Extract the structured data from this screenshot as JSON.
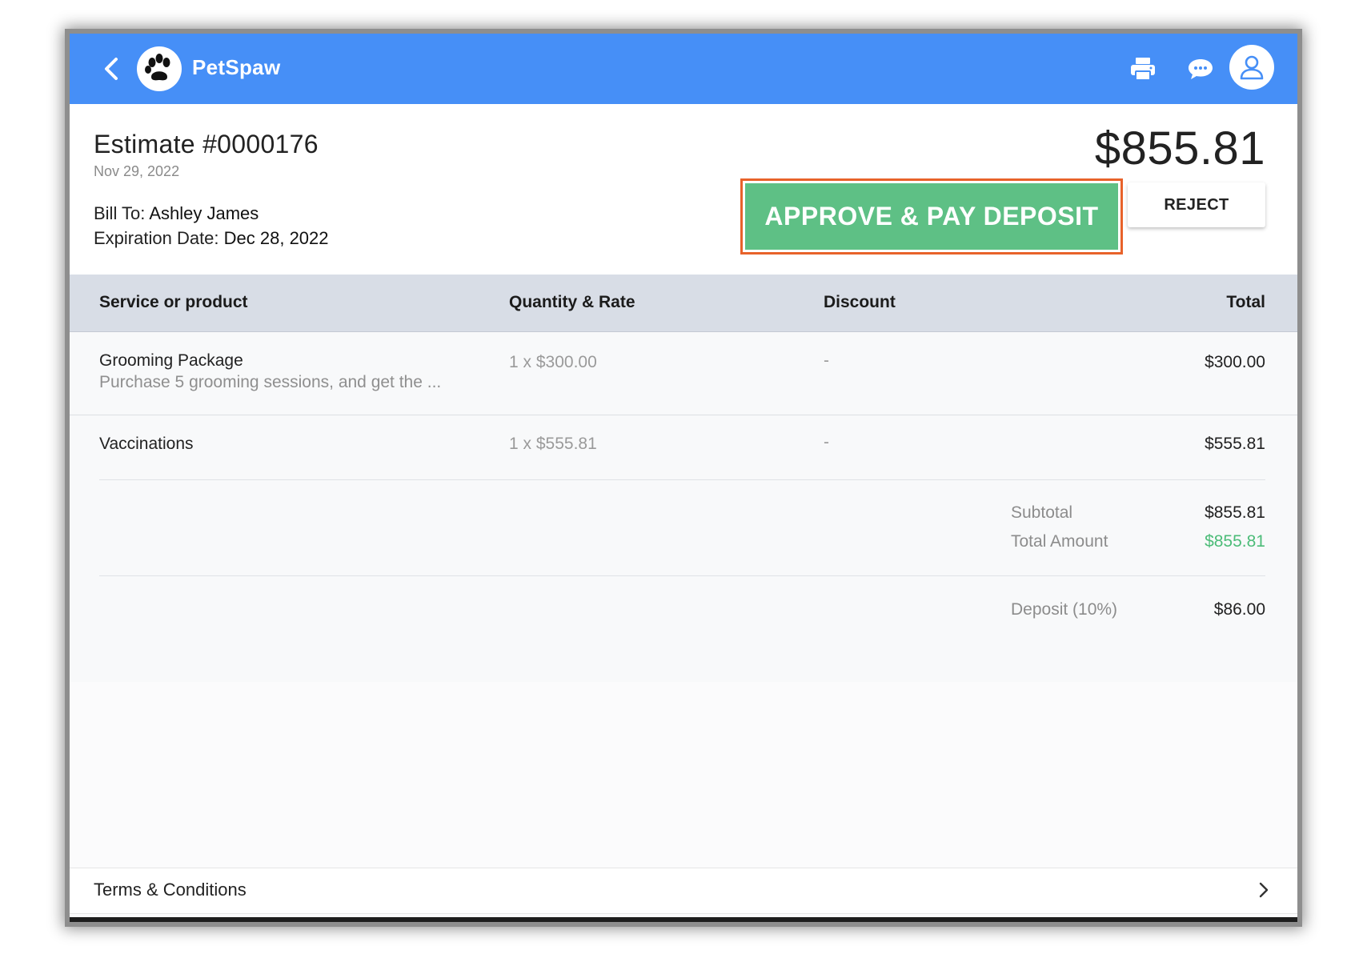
{
  "app": {
    "brand": "PetSpaw"
  },
  "topbar": {
    "icons": [
      "back-chevron-icon",
      "paw-logo-icon",
      "printer-icon",
      "chat-icon",
      "user-icon"
    ],
    "color": "#468ff7"
  },
  "estimate": {
    "title": "Estimate #0000176",
    "date": "Nov 29, 2022",
    "bill_to_label": "Bill To: ",
    "bill_to_name": "Ashley James",
    "expiration_label": "Expiration Date: ",
    "expiration_date": "Dec 28, 2022",
    "total": "$855.81"
  },
  "actions": {
    "approve_label": "APPROVE & PAY DEPOSIT",
    "reject_label": "REJECT",
    "approve_color": "#5ec085",
    "highlight_color": "#e8622a"
  },
  "table": {
    "headers": [
      "Service or product",
      "Quantity & Rate",
      "Discount",
      "Total"
    ],
    "rows": [
      {
        "name": "Grooming Package",
        "description": "Purchase 5 grooming sessions, and get the ...",
        "qty_rate": "1 x $300.00",
        "discount": "-",
        "total": "$300.00"
      },
      {
        "name": "Vaccinations",
        "description": "",
        "qty_rate": "1 x $555.81",
        "discount": "-",
        "total": "$555.81"
      }
    ]
  },
  "summary": {
    "subtotal_label": "Subtotal",
    "subtotal_value": "$855.81",
    "total_amount_label": "Total Amount",
    "total_amount_value": "$855.81",
    "deposit_label": "Deposit (10%)",
    "deposit_value": "$86.00"
  },
  "footer": {
    "terms_label": "Terms & Conditions"
  }
}
